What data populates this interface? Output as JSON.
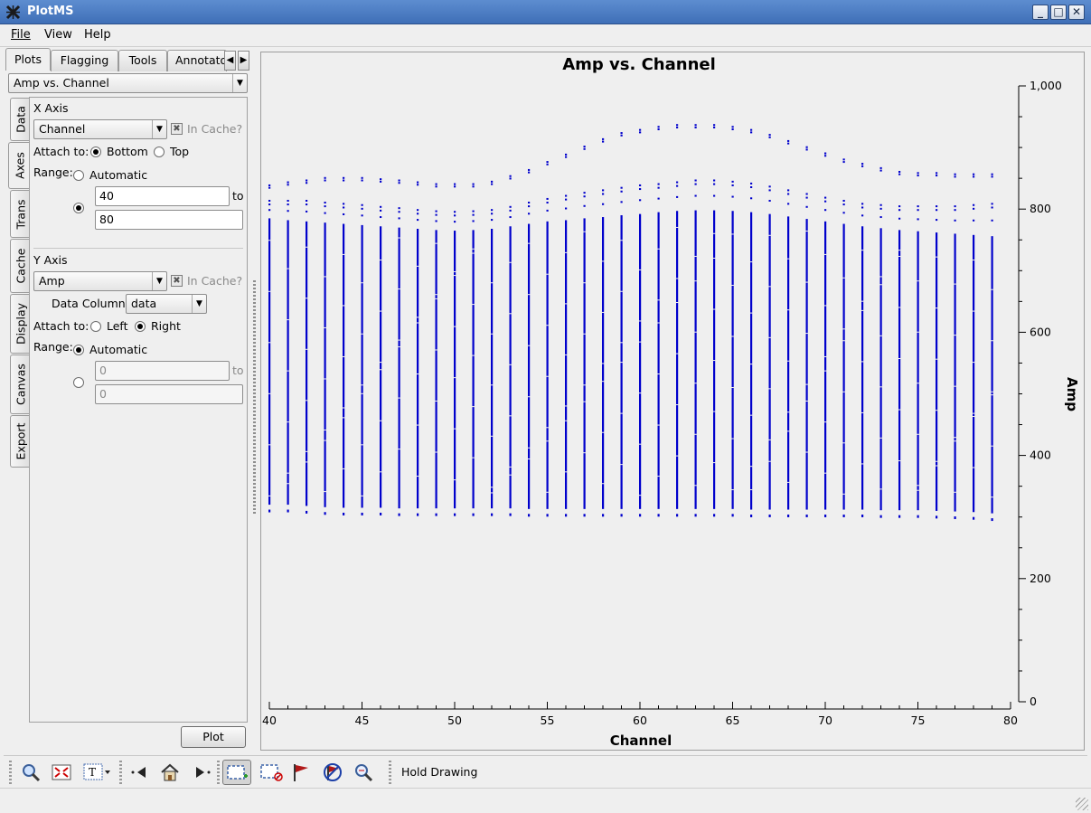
{
  "window": {
    "title": "PlotMS",
    "minimize": "_",
    "maximize": "□",
    "close": "✕"
  },
  "menu": [
    "File",
    "View",
    "Help"
  ],
  "top_tabs": [
    "Plots",
    "Flagging",
    "Tools",
    "Annotato"
  ],
  "plot_selector": "Amp vs. Channel",
  "side_tabs": [
    "Data",
    "Axes",
    "Trans",
    "Cache",
    "Display",
    "Canvas",
    "Export"
  ],
  "x_axis": {
    "heading": "X Axis",
    "axis": "Channel",
    "in_cache": "In Cache?",
    "attach_label": "Attach to:",
    "attach_options": [
      "Bottom",
      "Top"
    ],
    "attach_selected": "Bottom",
    "range_label": "Range:",
    "range_auto": "Automatic",
    "range_min": "40",
    "range_to": "to",
    "range_max": "80"
  },
  "y_axis": {
    "heading": "Y Axis",
    "axis": "Amp",
    "in_cache": "In Cache?",
    "data_column_label": "Data Column:",
    "data_column": "data",
    "attach_label": "Attach to:",
    "attach_options": [
      "Left",
      "Right"
    ],
    "attach_selected": "Right",
    "range_label": "Range:",
    "range_auto": "Automatic",
    "range_min": "0",
    "range_to": "to",
    "range_max": "0"
  },
  "plot_button": "Plot",
  "toolbar": {
    "icons": [
      "zoom-icon",
      "zoom-fit-icon",
      "annotate-text-icon",
      "step-back-icon",
      "home-icon",
      "step-forward-icon",
      "select-region-icon",
      "subtract-region-icon",
      "flag-icon",
      "unflag-icon",
      "locate-icon"
    ],
    "hold_drawing": "Hold Drawing"
  },
  "chart_data": {
    "type": "scatter",
    "title": "Amp vs. Channel",
    "xlabel": "Channel",
    "ylabel": "Amp",
    "xlim": [
      40,
      80
    ],
    "ylim": [
      0,
      1000
    ],
    "x_ticks": [
      "40",
      "45",
      "50",
      "55",
      "60",
      "65",
      "70",
      "75",
      "80"
    ],
    "y_ticks": [
      "0",
      "200",
      "400",
      "600",
      "800",
      "1,000"
    ],
    "y_axis_side": "right",
    "marker_color": "#0000cc",
    "channels": [
      40,
      41,
      42,
      43,
      44,
      45,
      46,
      47,
      48,
      49,
      50,
      51,
      52,
      53,
      54,
      55,
      56,
      57,
      58,
      59,
      60,
      61,
      62,
      63,
      64,
      65,
      66,
      67,
      68,
      69,
      70,
      71,
      72,
      73,
      74,
      75,
      76,
      77,
      78,
      79
    ],
    "upper_envelope": [
      840,
      845,
      848,
      852,
      852,
      852,
      850,
      848,
      845,
      842,
      842,
      842,
      846,
      855,
      865,
      878,
      890,
      903,
      915,
      925,
      930,
      935,
      938,
      938,
      938,
      935,
      930,
      922,
      912,
      902,
      892,
      882,
      875,
      868,
      862,
      860,
      860,
      858,
      858,
      858
    ],
    "second_band": [
      815,
      815,
      815,
      812,
      810,
      808,
      805,
      803,
      800,
      798,
      797,
      798,
      800,
      805,
      812,
      818,
      823,
      828,
      832,
      836,
      840,
      842,
      845,
      848,
      848,
      846,
      843,
      838,
      832,
      826,
      820,
      815,
      810,
      808,
      806,
      806,
      806,
      806,
      808,
      810
    ],
    "column_top": [
      785,
      782,
      780,
      778,
      776,
      774,
      772,
      770,
      768,
      766,
      765,
      766,
      768,
      772,
      776,
      780,
      782,
      785,
      787,
      790,
      792,
      795,
      797,
      798,
      798,
      797,
      795,
      792,
      788,
      784,
      780,
      776,
      772,
      769,
      766,
      764,
      762,
      760,
      758,
      756
    ],
    "column_bottom": [
      320,
      320,
      318,
      316,
      315,
      315,
      315,
      314,
      314,
      314,
      314,
      314,
      314,
      314,
      313,
      313,
      313,
      313,
      313,
      313,
      313,
      313,
      313,
      313,
      313,
      313,
      312,
      312,
      312,
      312,
      312,
      312,
      312,
      311,
      311,
      311,
      310,
      309,
      308,
      306
    ]
  }
}
